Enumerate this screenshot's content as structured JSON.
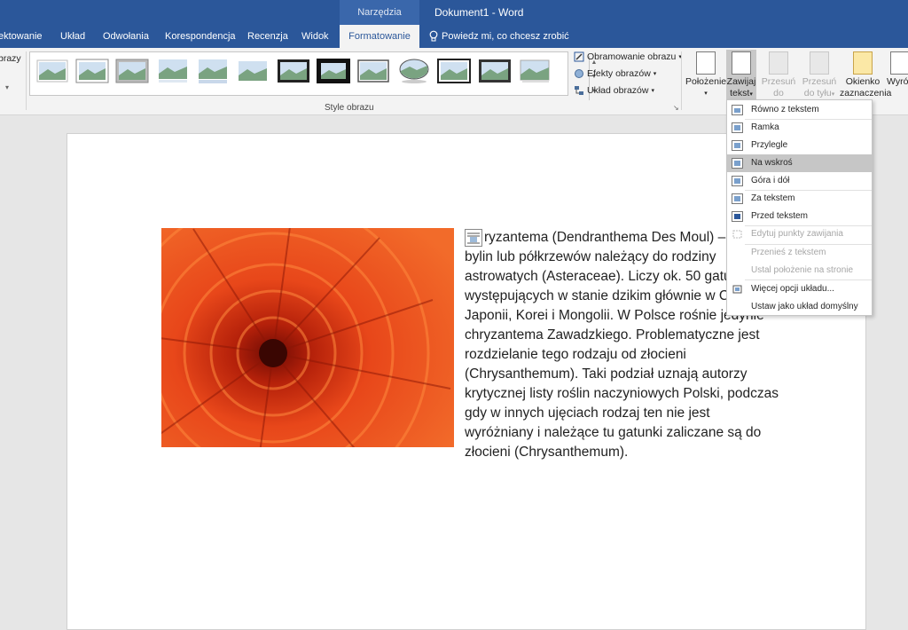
{
  "titlebar": {
    "context_label": "Narzędzia obrazów",
    "title": "Dokument1 - Word"
  },
  "tabs": [
    {
      "label": "ektowanie"
    },
    {
      "label": "Układ"
    },
    {
      "label": "Odwołania"
    },
    {
      "label": "Korespondencja"
    },
    {
      "label": "Recenzja"
    },
    {
      "label": "Widok"
    },
    {
      "label": "Formatowanie",
      "active": true
    },
    {
      "label": "Powiedz mi, co chcesz zrobić"
    }
  ],
  "ribbon": {
    "left_stub": "brazy",
    "picture_styles_label": "Style obrazu",
    "commands": {
      "border": "Obramowanie obrazu",
      "effects": "Efekty obrazów",
      "layout": "Układ obrazów"
    },
    "arrange": {
      "position": "Położenie",
      "wrap_text_1": "Zawijaj",
      "wrap_text_2": "tekst",
      "bring_forward_1": "Przesuń do",
      "bring_forward_2": "przodu",
      "send_backward_1": "Przesuń",
      "send_backward_2": "do tyłu",
      "selection_pane_1": "Okienko",
      "selection_pane_2": "zaznaczenia",
      "align": "Wyró"
    }
  },
  "wrap_menu": {
    "items": [
      {
        "label": "Równo z tekstem"
      },
      {
        "label": "Ramka"
      },
      {
        "label": "Przylegle"
      },
      {
        "label": "Na wskroś",
        "highlighted": true
      },
      {
        "label": "Góra i dół"
      },
      {
        "label": "Za tekstem"
      },
      {
        "label": "Przed tekstem"
      },
      {
        "label": "Edytuj punkty zawijania",
        "disabled": true
      },
      {
        "label": "Przenieś z tekstem",
        "disabled": true
      },
      {
        "label": "Ustal położenie na stronie",
        "disabled": true
      },
      {
        "label": "Więcej opcji układu..."
      },
      {
        "label": "Ustaw jako układ domyślny"
      }
    ]
  },
  "document": {
    "lines": [
      "ryzantema (Dendranthema Des Moul) – r",
      "bylin lub półkrzewów należący do rodziny",
      "astrowatych (Asteraceae). Liczy ok. 50 gatun",
      "występujących w stanie dzikim głównie w C",
      "Japonii, Korei i Mongolii. W Polsce rośnie jedynie",
      "chryzantema Zawadzkiego. Problematyczne jest",
      "rozdzielanie tego rodzaju od złocieni",
      "(Chrysanthemum). Taki podział uznają autorzy",
      "krytycznej listy roślin naczyniowych Polski, podczas",
      "gdy w innych ujęciach rodzaj ten nie jest",
      "wyróżniany i należące tu gatunki zaliczane są do",
      "złocieni (Chrysanthemum)."
    ]
  },
  "colors": {
    "brand": "#2b579a",
    "flower": "#e8471a"
  }
}
